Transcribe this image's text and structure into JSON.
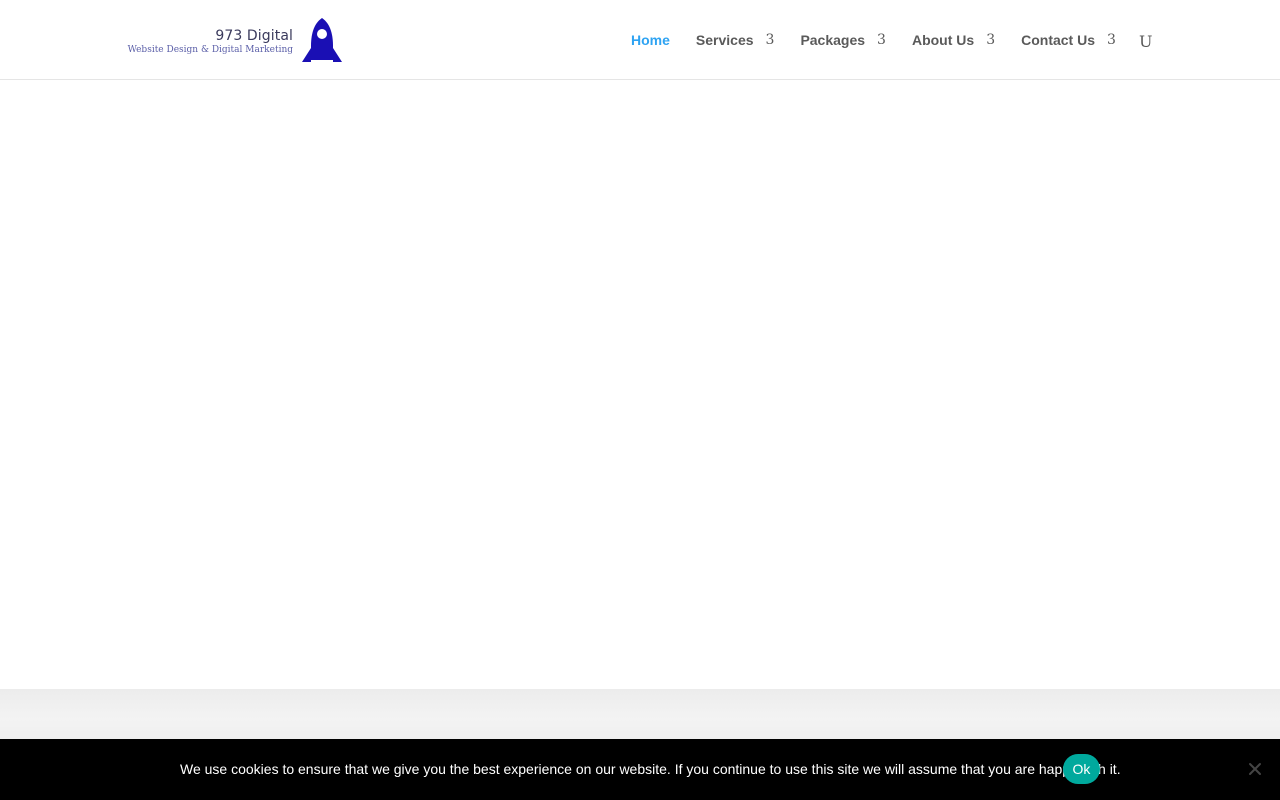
{
  "brand": {
    "name": "973 Digital",
    "tagline": "Website Design & Digital Marketing",
    "rocket_color": "#1a0fb4",
    "icon": "rocket-icon"
  },
  "nav": {
    "items": [
      {
        "label": "Home",
        "active": true
      },
      {
        "label": "Services",
        "dropdown": "3"
      },
      {
        "label": "Packages",
        "dropdown": "3"
      },
      {
        "label": "About Us",
        "dropdown": "3"
      },
      {
        "label": "Contact Us",
        "dropdown": "3"
      }
    ],
    "search_glyph": "U",
    "active_color": "#2ea3f2",
    "text_color": "#5a5a5a"
  },
  "cookie": {
    "message": "We use cookies to ensure that we give you the best experience on our website. If you continue to use this site we will assume that you are happy with it.",
    "ok_label": "Ok",
    "ok_color": "#00a99d",
    "close_icon": "close-icon"
  }
}
